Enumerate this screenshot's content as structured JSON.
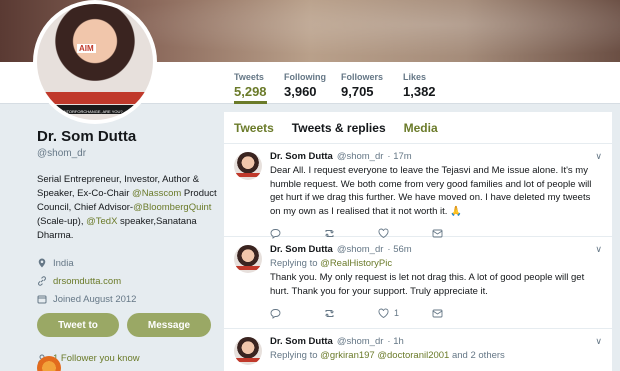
{
  "profile": {
    "name": "Dr. Som Dutta",
    "handle": "@shom_dr",
    "avatar_badge": "AIM",
    "avatar_slogan": "I AM A #MENTORFORCHANGE, ARE YOU?",
    "bio_parts": {
      "p1": "Serial Entrepreneur, Investor, Author & Speaker, Ex-Co-Chair ",
      "l1": "@Nasscom",
      "p2": " Product Council, Chief Advisor-",
      "l2": "@BloombergQuint",
      "p3": " (Scale-up), ",
      "l3": "@TedX",
      "p4": " speaker,Sanatana Dharma."
    },
    "location": "India",
    "website": "drsomdutta.com",
    "joined": "Joined August 2012",
    "tweet_to_label": "Tweet to",
    "message_label": "Message",
    "followers_you_know": "1 Follower you know"
  },
  "stats": [
    {
      "label": "Tweets",
      "value": "5,298"
    },
    {
      "label": "Following",
      "value": "3,960"
    },
    {
      "label": "Followers",
      "value": "9,705"
    },
    {
      "label": "Likes",
      "value": "1,382"
    }
  ],
  "tabs": [
    {
      "label": "Tweets"
    },
    {
      "label": "Tweets & replies"
    },
    {
      "label": "Media"
    }
  ],
  "tweets": [
    {
      "name": "Dr. Som Dutta",
      "handle": "@shom_dr",
      "time": "· 17m",
      "text": "Dear All. I request everyone to leave the Tejasvi and Me issue alone. It's my humble request. We both come from very good families and lot of people will get hurt if we drag this further. We have moved on. I have deleted my tweets on my own as I realised that it not worth it. 🙏",
      "like_count": ""
    },
    {
      "name": "Dr. Som Dutta",
      "handle": "@shom_dr",
      "time": "· 56m",
      "replying_prefix": "Replying to ",
      "replying_to": "@RealHistoryPic",
      "text": "Thank you. My only request is let not drag this. A lot of good people will get hurt. Thank you for your support. Truly appreciate it.",
      "like_count": "1"
    },
    {
      "name": "Dr. Som Dutta",
      "handle": "@shom_dr",
      "time": "· 1h",
      "replying_prefix": "Replying to ",
      "replying_to_1": "@grkiran197",
      "replying_to_2": "@doctoranil2001",
      "replying_suffix": " and 2 others"
    }
  ],
  "colors": {
    "accent": "#6b7b2a",
    "button": "#9aa865",
    "background": "#e6ecf0"
  }
}
